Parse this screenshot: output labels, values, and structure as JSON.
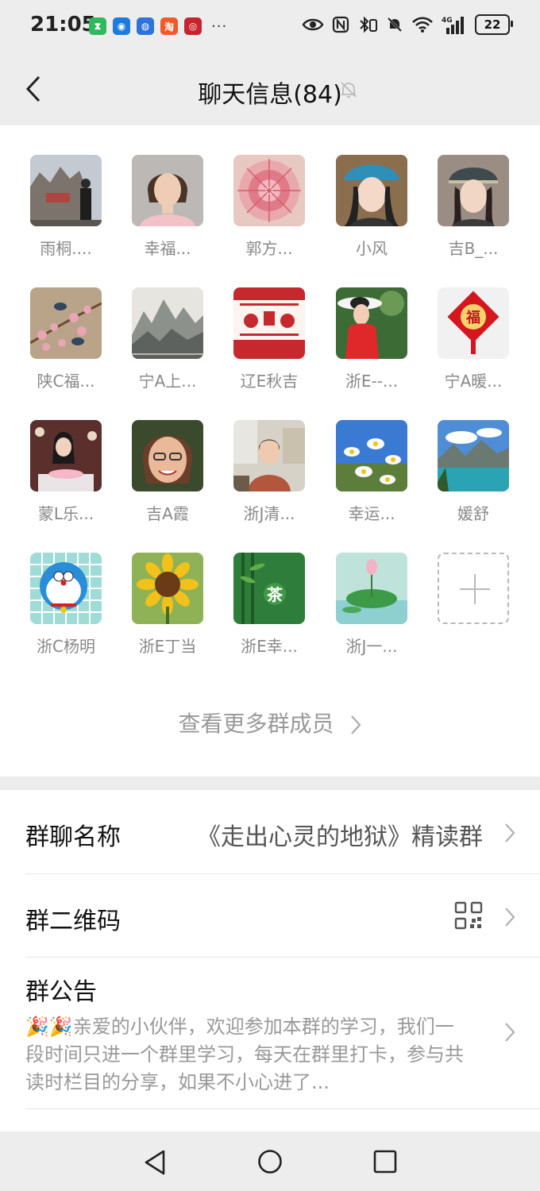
{
  "status_bar": {
    "time": "21:05",
    "battery": "22",
    "more": "···"
  },
  "nav": {
    "title": "聊天信息(84)"
  },
  "members": [
    {
      "name": "雨桐....",
      "avatar": "avatar-scenic-rock"
    },
    {
      "name": "幸福...",
      "avatar": "avatar-woman-portrait"
    },
    {
      "name": "郭方...",
      "avatar": "avatar-pink-mandala"
    },
    {
      "name": "小风",
      "avatar": "avatar-woman-blue-hat"
    },
    {
      "name": "吉B_...",
      "avatar": "avatar-woman-cap"
    },
    {
      "name": "陕C福...",
      "avatar": "avatar-blossom-bird"
    },
    {
      "name": "宁A上...",
      "avatar": "avatar-ink-mountain"
    },
    {
      "name": "辽E秋吉",
      "avatar": "avatar-paper-cut"
    },
    {
      "name": "浙E--...",
      "avatar": "avatar-woman-white-hat"
    },
    {
      "name": "宁A暖...",
      "avatar": "avatar-fu-knot"
    },
    {
      "name": "蒙L乐...",
      "avatar": "avatar-woman-cake"
    },
    {
      "name": "吉A霞",
      "avatar": "avatar-woman-glasses"
    },
    {
      "name": "浙J清...",
      "avatar": "avatar-woman-indoor"
    },
    {
      "name": "幸运...",
      "avatar": "avatar-daisies"
    },
    {
      "name": "媛舒",
      "avatar": "avatar-lake-mountain"
    },
    {
      "name": "浙C杨明",
      "avatar": "avatar-doraemon"
    },
    {
      "name": "浙E丁当",
      "avatar": "avatar-sunflower"
    },
    {
      "name": "浙E幸...",
      "avatar": "avatar-bamboo-tea"
    },
    {
      "name": "浙J一...",
      "avatar": "avatar-lotus"
    }
  ],
  "view_more": "查看更多群成员",
  "settings": {
    "group_name_label": "群聊名称",
    "group_name_value": "《走出心灵的地狱》精读群",
    "qr_label": "群二维码",
    "notice_label": "群公告",
    "notice_text": "🎉🎉亲爱的小伙伴，欢迎参加本群的学习，我们一段时间只进一个群里学习，每天在群里打卡，参与共读时栏目的分享，如果不小心进了..."
  }
}
